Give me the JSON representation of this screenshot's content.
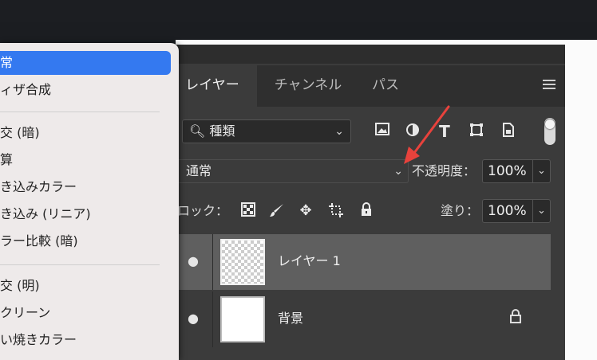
{
  "dropdown": {
    "items": [
      {
        "label": "常"
      },
      {
        "label": "ィザ合成"
      },
      {
        "label": "交 (暗)"
      },
      {
        "label": "算"
      },
      {
        "label": "き込みカラー"
      },
      {
        "label": "き込み (リニア)"
      },
      {
        "label": "ラー比較 (暗)"
      },
      {
        "label": "交 (明)"
      },
      {
        "label": "クリーン"
      },
      {
        "label": "い焼きカラー"
      }
    ],
    "selected_index": 0
  },
  "panel": {
    "tabs": [
      {
        "label": "レイヤー"
      },
      {
        "label": "チャンネル"
      },
      {
        "label": "パス"
      }
    ],
    "active_tab": 0,
    "filter": {
      "icon": "search-icon",
      "label": "種類"
    },
    "blend_mode": "通常",
    "opacity_label": "不透明度：",
    "opacity_value": "100%",
    "lock_label": "ロック：",
    "fill_label": "塗り：",
    "fill_value": "100%",
    "layers": [
      {
        "name": "レイヤー 1",
        "selected": true,
        "thumbnail": "transparent"
      },
      {
        "name": "背景",
        "selected": false,
        "thumbnail": "white",
        "locked": true
      }
    ]
  },
  "colors": {
    "panel_bg": "#3b3b3b",
    "selected_row": "#5f5f5f",
    "dropdown_selected": "#3479f0",
    "annotation_arrow": "#e8423c"
  }
}
